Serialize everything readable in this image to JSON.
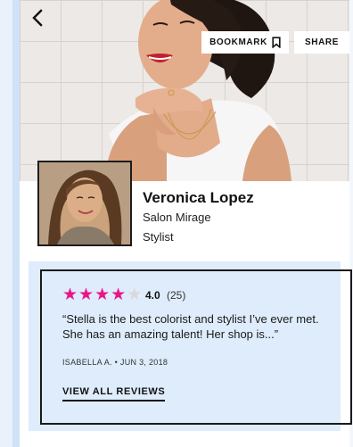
{
  "header": {
    "back_icon": "chevron-left-icon",
    "bookmark_label": "BOOKMARK",
    "bookmark_icon": "bookmark-icon",
    "share_label": "SHARE"
  },
  "profile": {
    "name": "Veronica Lopez",
    "salon": "Salon Mirage",
    "role": "Stylist"
  },
  "review": {
    "rating": "4.0",
    "rating_value": 4,
    "rating_max": 5,
    "count": "(25)",
    "quote": "“Stella is the best colorist and stylist I’ve ever met. She has an amazing talent! Her shop is...”",
    "byline": "ISABELLA A. • JUN 3, 2018",
    "view_all_label": "VIEW ALL REVIEWS"
  },
  "colors": {
    "star_filled": "#e8158c",
    "star_empty": "#d9d9d9",
    "card_background": "#deecfb"
  }
}
